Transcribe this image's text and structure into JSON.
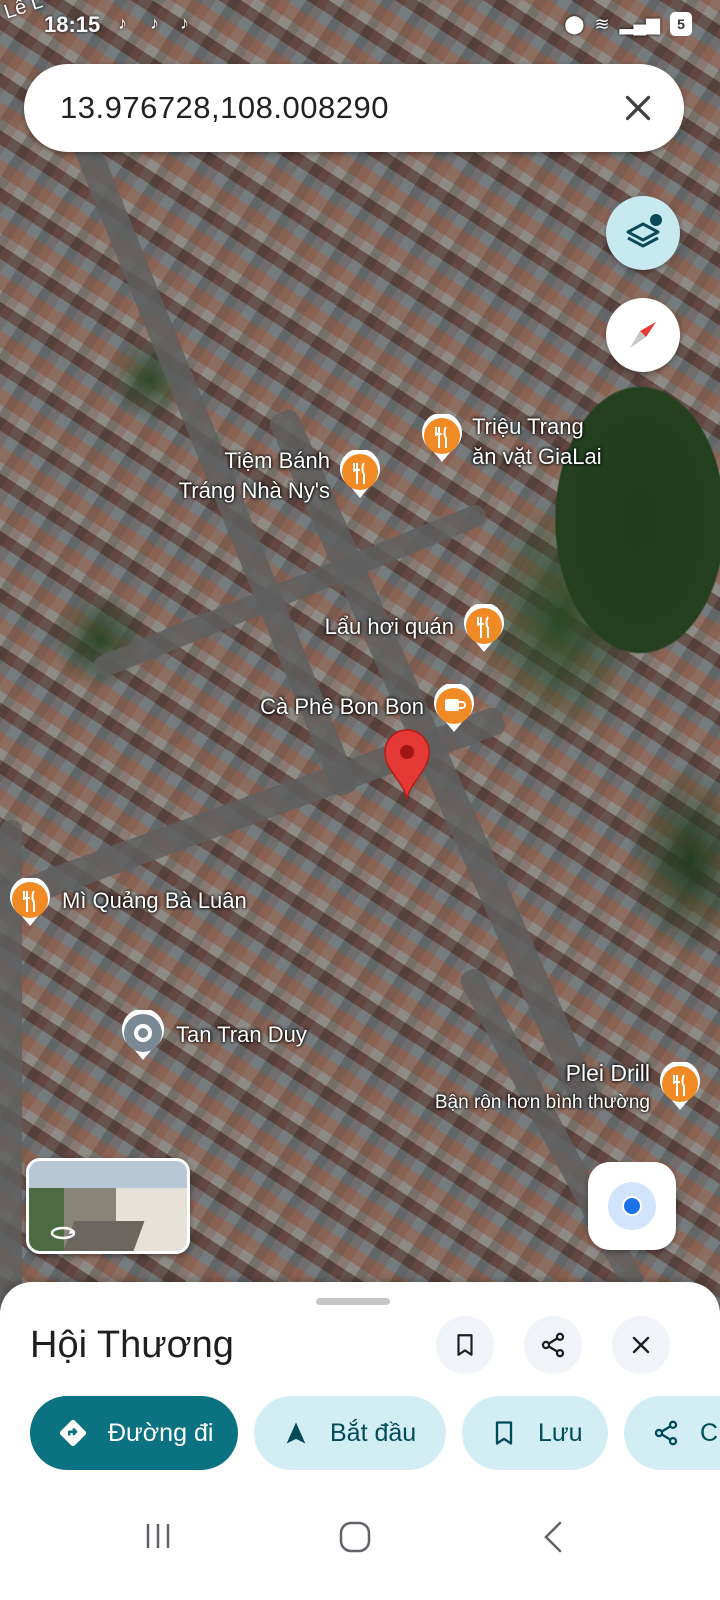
{
  "status_bar": {
    "time": "18:15",
    "battery": "5",
    "street_label": "Lê L"
  },
  "search": {
    "query": "13.976728,108.008290"
  },
  "map": {
    "places": [
      {
        "name": "Triệu Trang\năn vặt GiaLai",
        "kind": "restaurant"
      },
      {
        "name": "Tiệm Bánh\nTráng Nhà Ny's",
        "kind": "restaurant"
      },
      {
        "name": "Lẩu hơi quán",
        "kind": "restaurant"
      },
      {
        "name": "Cà Phê Bon Bon",
        "kind": "cafe"
      },
      {
        "name": "Mì Quảng Bà Luân",
        "kind": "restaurant"
      },
      {
        "name": "Tan Tran Duy",
        "kind": "place"
      },
      {
        "name": "Plei Drill",
        "subtitle": "Bận rộn hơn bình thường",
        "kind": "restaurant"
      }
    ],
    "colors": {
      "food_pin": "#f08a24",
      "dropped_pin": "#e53935"
    }
  },
  "sheet": {
    "title": "Hội Thương",
    "actions": {
      "directions": "Đường đi",
      "start": "Bắt đầu",
      "save": "Lưu",
      "share": "C"
    }
  },
  "colors": {
    "accent": "#0b7281",
    "chip": "#d3edf4"
  }
}
